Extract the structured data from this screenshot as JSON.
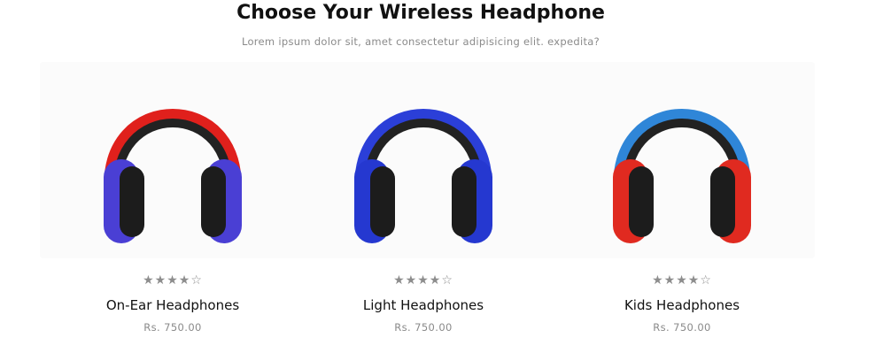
{
  "section": {
    "title": "Choose Your Wireless Headphone",
    "subtitle": "Lorem ipsum dolor sit, amet consectetur adipisicing elit. expedita?"
  },
  "products": [
    {
      "name": "On-Ear Headphones",
      "price": "Rs. 750.00",
      "rating": 4.5,
      "stars": "★★★★☆",
      "colors": {
        "band": "#e0201c",
        "cup": "#4a3fd4",
        "accent": "#e0201c"
      }
    },
    {
      "name": "Light Headphones",
      "price": "Rs. 750.00",
      "rating": 4.5,
      "stars": "★★★★☆",
      "colors": {
        "band": "#2b3fd8",
        "cup": "#2538d0",
        "accent": "#2b3fd8"
      }
    },
    {
      "name": "Kids Headphones",
      "price": "Rs. 750.00",
      "rating": 4.5,
      "stars": "★★★★☆",
      "colors": {
        "band": "#2f86d8",
        "cup": "#e02a20",
        "accent": "#2f86d8"
      }
    }
  ]
}
